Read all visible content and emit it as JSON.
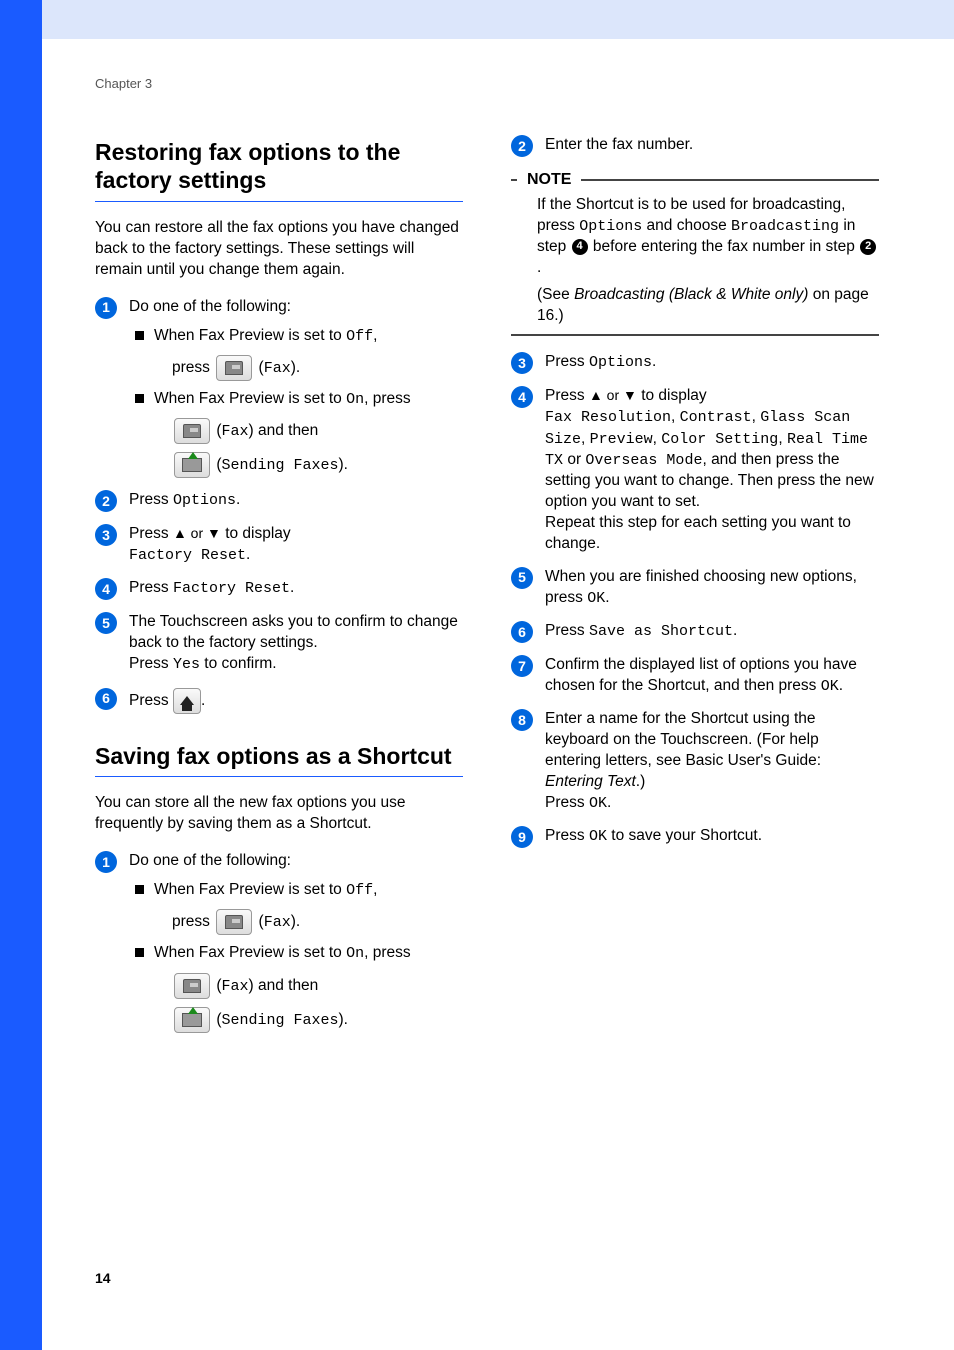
{
  "chapter": "Chapter 3",
  "section1": {
    "title": "Restoring fax options to the factory settings",
    "intro": "You can restore all the fax options you have changed back to the factory settings. These settings will remain until you change them again.",
    "steps": {
      "s1": {
        "lead": "Do one of the following:",
        "a_pre": "When Fax Preview is set to ",
        "a_code": "Off",
        "a_post": ",",
        "a2_pre": "press ",
        "a2_code": "Fax",
        "a2_post": ").",
        "b_pre": "When Fax Preview is set to ",
        "b_code": "On",
        "b_post": ", press",
        "b2_open": "(",
        "b2_code": "Fax",
        "b2_post": ") and then",
        "b3_open": "(",
        "b3_code": "Sending Faxes",
        "b3_post": ")."
      },
      "s2_pre": "Press ",
      "s2_code": "Options",
      "s2_post": ".",
      "s3_pre": "Press ",
      "s3_arrows": "▲ or ▼",
      "s3_mid": " to display ",
      "s3_code": "Factory Reset",
      "s3_post": ".",
      "s4_pre": "Press ",
      "s4_code": "Factory Reset",
      "s4_post": ".",
      "s5_a": "The Touchscreen asks you to confirm to change back to the factory settings.",
      "s5_b_pre": "Press ",
      "s5_b_code": "Yes",
      "s5_b_post": " to confirm.",
      "s6_pre": "Press ",
      "s6_post": "."
    }
  },
  "section2": {
    "title": "Saving fax options as a Shortcut",
    "intro": "You can store all the new fax options you use frequently by saving them as a Shortcut.",
    "s1": {
      "lead": "Do one of the following:",
      "a_pre": "When Fax Preview is set to ",
      "a_code": "Off",
      "a_post": ",",
      "a2_pre": "press ",
      "a2_code": "Fax",
      "a2_post": ").",
      "b_pre": "When Fax Preview is set to ",
      "b_code": "On",
      "b_post": ", press",
      "b2_open": "(",
      "b2_code": "Fax",
      "b2_post": ") and then",
      "b3_open": "(",
      "b3_code": "Sending Faxes",
      "b3_post": ")."
    }
  },
  "right": {
    "s2": "Enter the fax number.",
    "note": {
      "label": "NOTE",
      "p1_a": "If the Shortcut is to be used for broadcasting, press ",
      "p1_code1": "Options",
      "p1_b": " and choose ",
      "p1_code2": "Broadcasting",
      "p1_c": " in step ",
      "p1_ref1": "4",
      "p1_d": " before entering the fax number in step ",
      "p1_ref2": "2",
      "p1_e": ".",
      "p2_a": "(See ",
      "p2_i": "Broadcasting (Black & White only)",
      "p2_b": " on page 16.)"
    },
    "s3_pre": "Press ",
    "s3_code": "Options",
    "s3_post": ".",
    "s4_pre": "Press ",
    "s4_arrows": "▲ or ▼",
    "s4_mid": " to display ",
    "s4_c1": "Fax Resolution",
    "s4_sep": ", ",
    "s4_c2": "Contrast",
    "s4_c3": "Glass Scan Size",
    "s4_c4": "Preview",
    "s4_c5": "Color Setting",
    "s4_c6": "Real Time TX",
    "s4_or": " or ",
    "s4_c7": "Overseas Mode",
    "s4_tail": ", and then press the setting you want to change. Then press the new option you want to set.",
    "s4_repeat": "Repeat this step for each setting you want to change.",
    "s5_a": "When you are finished choosing new options, press ",
    "s5_code": "OK",
    "s5_post": ".",
    "s6_pre": "Press ",
    "s6_code": "Save as Shortcut",
    "s6_post": ".",
    "s7_a": "Confirm the displayed list of options  you have chosen for the Shortcut, and then press ",
    "s7_code": "OK",
    "s7_post": ".",
    "s8_a": "Enter a name for the Shortcut using the keyboard on the Touchscreen. (For help entering letters, see  Basic User's Guide: ",
    "s8_i": "Entering Text",
    "s8_b": ".)",
    "s8_c": "Press ",
    "s8_code": "OK",
    "s8_post": ".",
    "s9_pre": "Press ",
    "s9_code": "OK",
    "s9_post": " to save your Shortcut."
  },
  "page": "14"
}
